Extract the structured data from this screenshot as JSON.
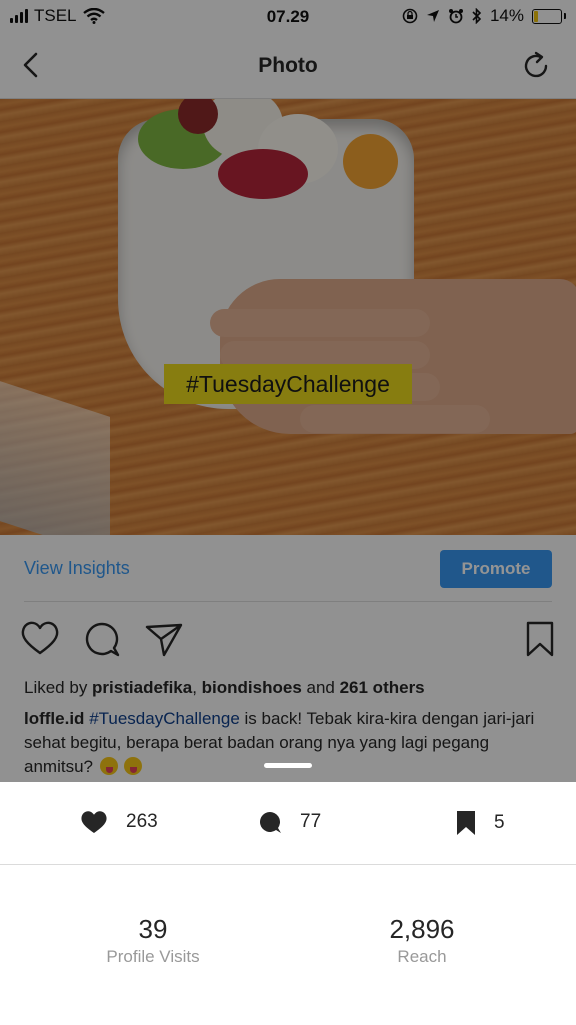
{
  "status_bar": {
    "carrier": "TSEL",
    "time": "07.29",
    "battery_percent": "14%",
    "battery_level": 0.14
  },
  "header": {
    "title": "Photo",
    "back_icon": "chevron-left-icon",
    "refresh_icon": "refresh-icon"
  },
  "photo": {
    "overlay_text": "#TuesdayChallenge"
  },
  "insights": {
    "view_insights_label": "View Insights",
    "promote_label": "Promote"
  },
  "post": {
    "liked_by_prefix": "Liked by ",
    "liker_1": "pristiadefika",
    "separator": ", ",
    "liker_2": "biondishoes",
    "and_text": " and ",
    "others": "261 others",
    "caption_user": "loffle.id",
    "caption_hashtag": "#TuesdayChallenge",
    "caption_text": " is back! Tebak kira-kira dengan jari-jari sehat begitu, berapa berat badan orang nya yang lagi pegang anmitsu? "
  },
  "sheet_stats": {
    "likes": "263",
    "comments": "77",
    "saves": "5",
    "profile_visits_value": "39",
    "profile_visits_label": "Profile Visits",
    "reach_value": "2,896",
    "reach_label": "Reach"
  },
  "colors": {
    "link_blue": "#3897f0",
    "hashtag_blue": "#0f3e8a",
    "tag_yellow": "#e8d81d",
    "battery_yellow": "#f1c40f"
  }
}
